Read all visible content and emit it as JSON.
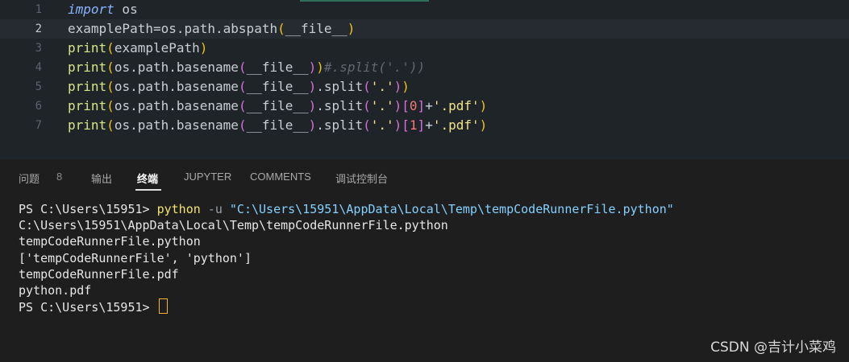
{
  "editor": {
    "lines": [
      {
        "num": "1",
        "tokens": [
          {
            "t": "import",
            "c": "kw"
          },
          {
            "t": " os",
            "c": "plain"
          }
        ]
      },
      {
        "num": "2",
        "active": true,
        "tokens": [
          {
            "t": "examplePath=os.path.abspath",
            "c": "plain"
          },
          {
            "t": "(",
            "c": "paren"
          },
          {
            "t": "__file__",
            "c": "plain"
          },
          {
            "t": ")",
            "c": "paren"
          }
        ]
      },
      {
        "num": "3",
        "tokens": [
          {
            "t": "print",
            "c": "builtin"
          },
          {
            "t": "(",
            "c": "paren"
          },
          {
            "t": "examplePath",
            "c": "plain"
          },
          {
            "t": ")",
            "c": "paren"
          }
        ]
      },
      {
        "num": "4",
        "tokens": [
          {
            "t": "print",
            "c": "builtin"
          },
          {
            "t": "(",
            "c": "paren"
          },
          {
            "t": "os.path.basename",
            "c": "plain"
          },
          {
            "t": "(",
            "c": "paren2"
          },
          {
            "t": "__file__",
            "c": "plain"
          },
          {
            "t": ")",
            "c": "paren2"
          },
          {
            "t": ")",
            "c": "paren"
          },
          {
            "t": "#.split('.'))",
            "c": "cmt"
          }
        ]
      },
      {
        "num": "5",
        "tokens": [
          {
            "t": "print",
            "c": "builtin"
          },
          {
            "t": "(",
            "c": "paren"
          },
          {
            "t": "os.path.basename",
            "c": "plain"
          },
          {
            "t": "(",
            "c": "paren2"
          },
          {
            "t": "__file__",
            "c": "plain"
          },
          {
            "t": ")",
            "c": "paren2"
          },
          {
            "t": ".split",
            "c": "plain"
          },
          {
            "t": "(",
            "c": "paren2"
          },
          {
            "t": "'.'",
            "c": "str"
          },
          {
            "t": ")",
            "c": "paren2"
          },
          {
            "t": ")",
            "c": "paren"
          }
        ]
      },
      {
        "num": "6",
        "tokens": [
          {
            "t": "print",
            "c": "builtin"
          },
          {
            "t": "(",
            "c": "paren"
          },
          {
            "t": "os.path.basename",
            "c": "plain"
          },
          {
            "t": "(",
            "c": "paren2"
          },
          {
            "t": "__file__",
            "c": "plain"
          },
          {
            "t": ")",
            "c": "paren2"
          },
          {
            "t": ".split",
            "c": "plain"
          },
          {
            "t": "(",
            "c": "paren2"
          },
          {
            "t": "'.'",
            "c": "str"
          },
          {
            "t": ")",
            "c": "paren2"
          },
          {
            "t": "[",
            "c": "paren2"
          },
          {
            "t": "0",
            "c": "num"
          },
          {
            "t": "]",
            "c": "paren2"
          },
          {
            "t": "+",
            "c": "plain"
          },
          {
            "t": "'.pdf'",
            "c": "str"
          },
          {
            "t": ")",
            "c": "paren"
          }
        ]
      },
      {
        "num": "7",
        "tokens": [
          {
            "t": "print",
            "c": "builtin"
          },
          {
            "t": "(",
            "c": "paren"
          },
          {
            "t": "os.path.basename",
            "c": "plain"
          },
          {
            "t": "(",
            "c": "paren2"
          },
          {
            "t": "__file__",
            "c": "plain"
          },
          {
            "t": ")",
            "c": "paren2"
          },
          {
            "t": ".split",
            "c": "plain"
          },
          {
            "t": "(",
            "c": "paren2"
          },
          {
            "t": "'.'",
            "c": "str"
          },
          {
            "t": ")",
            "c": "paren2"
          },
          {
            "t": "[",
            "c": "paren2"
          },
          {
            "t": "1",
            "c": "num"
          },
          {
            "t": "]",
            "c": "paren2"
          },
          {
            "t": "+",
            "c": "plain"
          },
          {
            "t": "'.pdf'",
            "c": "str"
          },
          {
            "t": ")",
            "c": "paren"
          }
        ]
      }
    ]
  },
  "panel": {
    "tabs": {
      "problems": "问题",
      "problems_count": "8",
      "output": "输出",
      "terminal": "终端",
      "jupyter": "JUPYTER",
      "comments": "COMMENTS",
      "debug_console": "调试控制台"
    }
  },
  "terminal": {
    "prompt": "PS C:\\Users\\15951> ",
    "command": "python",
    "flag": " -u ",
    "path_arg": "\"C:\\Users\\15951\\AppData\\Local\\Temp\\tempCodeRunnerFile.python\"",
    "output_lines": [
      "C:\\Users\\15951\\AppData\\Local\\Temp\\tempCodeRunnerFile.python",
      "tempCodeRunnerFile.python",
      "['tempCodeRunnerFile', 'python']",
      "tempCodeRunnerFile.pdf",
      "python.pdf"
    ],
    "final_prompt": "PS C:\\Users\\15951> "
  },
  "watermark": "CSDN @吉计小菜鸡"
}
